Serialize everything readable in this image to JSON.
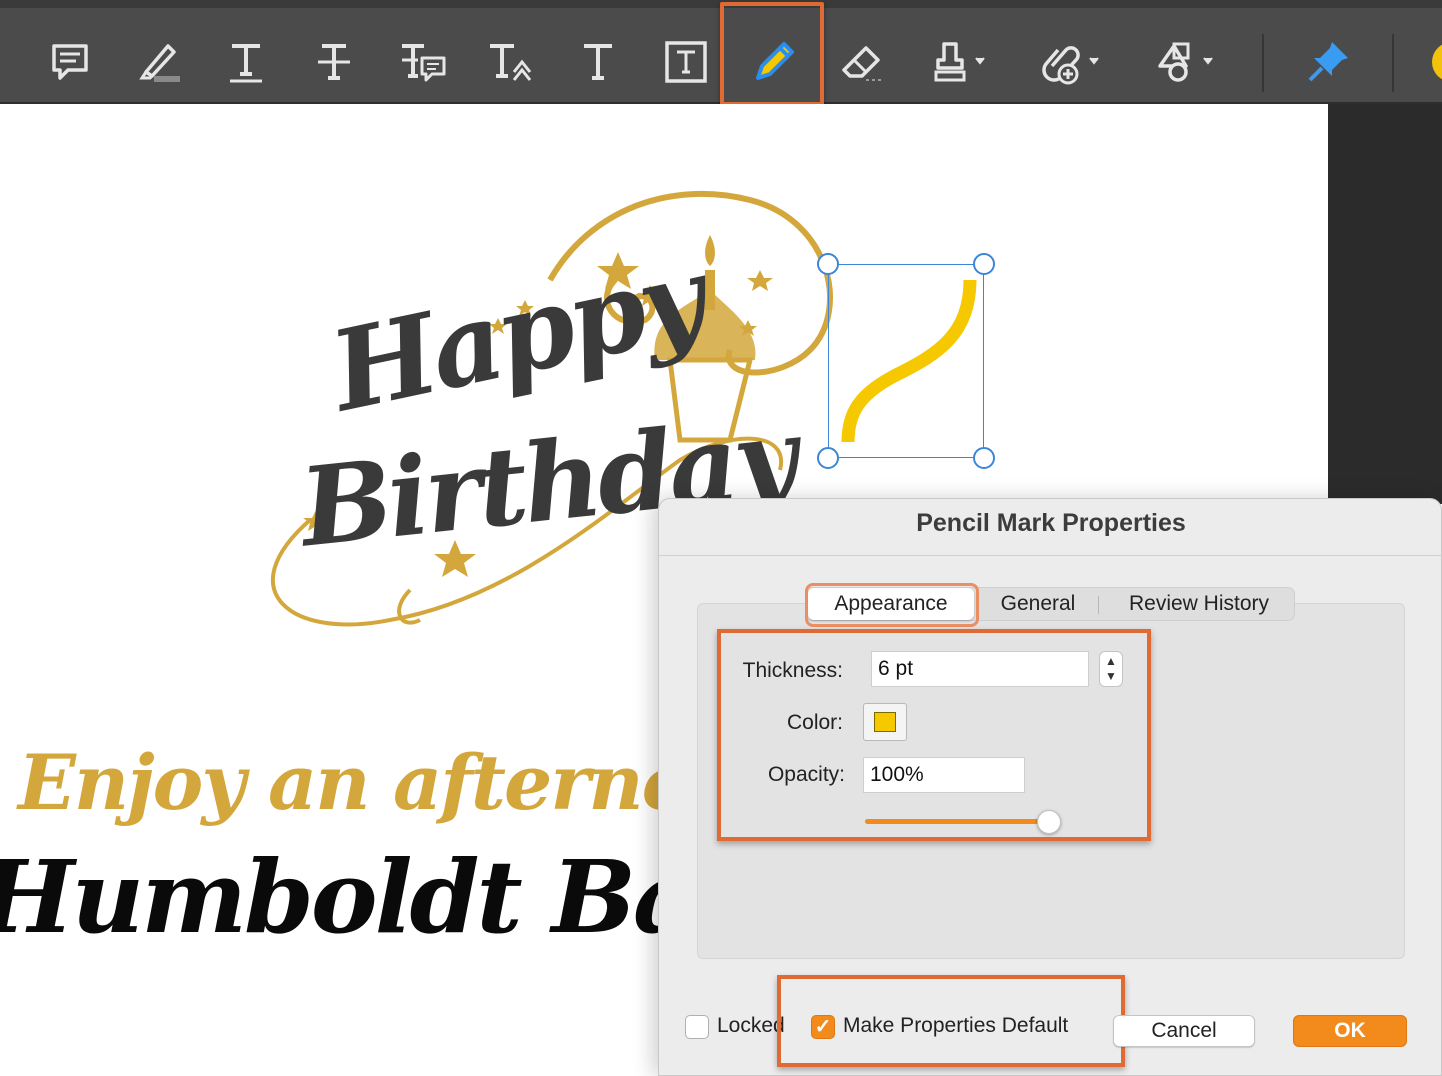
{
  "toolbar": {
    "tools": [
      {
        "name": "note-tool",
        "icon": "note-icon"
      },
      {
        "name": "highlight-tool",
        "icon": "highlighter-icon"
      },
      {
        "name": "underline-text-tool",
        "icon": "underline-text-icon"
      },
      {
        "name": "strikethrough-text-tool",
        "icon": "strikethrough-text-icon"
      },
      {
        "name": "replace-text-tool",
        "icon": "replace-text-icon"
      },
      {
        "name": "insert-text-tool",
        "icon": "insert-text-icon"
      },
      {
        "name": "typewriter-tool",
        "icon": "typewriter-icon"
      },
      {
        "name": "textbox-tool",
        "icon": "textbox-icon"
      },
      {
        "name": "pencil-tool",
        "icon": "pencil-icon",
        "active": true
      },
      {
        "name": "eraser-tool",
        "icon": "eraser-icon"
      },
      {
        "name": "stamp-tool",
        "icon": "stamp-icon"
      },
      {
        "name": "attachment-tool",
        "icon": "attachment-icon"
      },
      {
        "name": "shapes-tool",
        "icon": "shapes-icon"
      },
      {
        "name": "pin-tool",
        "icon": "pin-icon"
      }
    ],
    "accent_color": "#e06a34"
  },
  "document": {
    "art_text_line1": "Happy",
    "art_text_line2": "Birthday",
    "line_enjoy": "Enjoy an afternoon",
    "line_humboldt": "Humboldt Bay S",
    "pencil_mark_color": "#f5c800",
    "gold_color": "#d4a73c"
  },
  "dialog": {
    "title": "Pencil Mark Properties",
    "tabs": [
      {
        "label": "Appearance",
        "active": true
      },
      {
        "label": "General",
        "active": false
      },
      {
        "label": "Review History",
        "active": false
      }
    ],
    "thickness_label": "Thickness:",
    "thickness_value": "6 pt",
    "color_label": "Color:",
    "color_value": "#f5c800",
    "opacity_label": "Opacity:",
    "opacity_value": "100%",
    "opacity_fraction": 1.0,
    "locked_label": "Locked",
    "locked_checked": false,
    "make_default_label": "Make Properties Default",
    "make_default_checked": true,
    "cancel_label": "Cancel",
    "ok_label": "OK"
  }
}
